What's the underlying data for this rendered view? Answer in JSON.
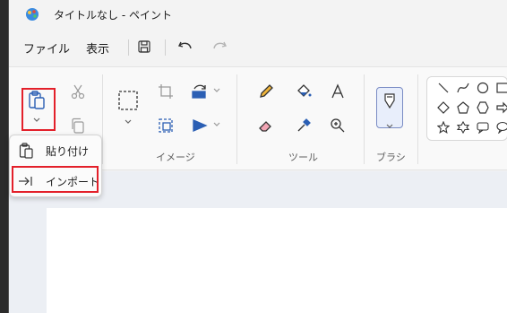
{
  "window": {
    "title": "タイトルなし - ペイント"
  },
  "menu": {
    "file": "ファイル",
    "view": "表示"
  },
  "ribbon": {
    "groups": {
      "image": "イメージ",
      "tools": "ツール",
      "brush": "ブラシ"
    }
  },
  "paste_menu": {
    "paste": "貼り付け",
    "import": "インポート"
  },
  "colors": {
    "accent": "#e3202a",
    "brush_border": "#7a8cc4"
  }
}
